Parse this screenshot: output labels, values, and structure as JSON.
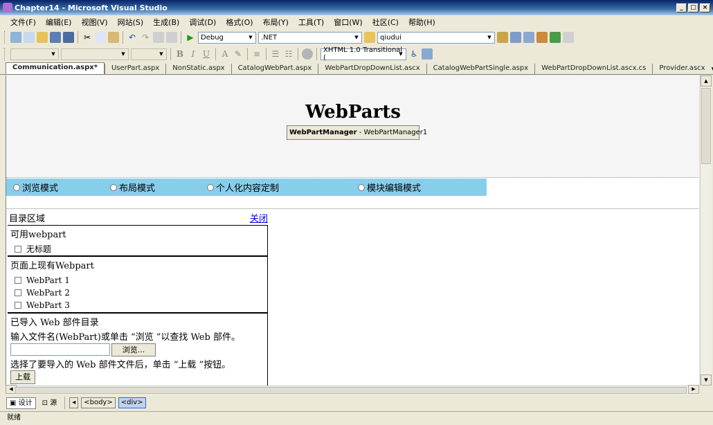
{
  "window": {
    "title": "Chapter14 - Microsoft Visual Studio"
  },
  "menu": [
    "文件(F)",
    "编辑(E)",
    "视图(V)",
    "网站(S)",
    "生成(B)",
    "调试(D)",
    "格式(O)",
    "布局(Y)",
    "工具(T)",
    "窗口(W)",
    "社区(C)",
    "帮助(H)"
  ],
  "toolbar": {
    "config": "Debug",
    "platform": ".NET",
    "search": "qiudui",
    "doctype": "XHTML 1.0 Transitional ("
  },
  "tabs": [
    "Communication.aspx*",
    "UserPart.aspx",
    "NonStatic.aspx",
    "CatalogWebPart.aspx",
    "WebPartDropDownList.ascx",
    "CatalogWebPartSingle.aspx",
    "WebPartDropDownList.ascx.cs",
    "Provider.ascx"
  ],
  "design": {
    "heading": "WebParts",
    "manager_type": "WebPartManager",
    "manager_id": " - WebPartManager1",
    "modes": [
      "浏览模式",
      "布局模式",
      "个人化内容定制",
      "模块编辑模式"
    ],
    "catalog": {
      "title": "目录区域",
      "close": "关闭",
      "available_title": "可用webpart",
      "available_items": [
        "无标题"
      ],
      "page_title": "页面上现有Webpart",
      "page_items": [
        "WebPart 1",
        "WebPart 2",
        "WebPart 3"
      ],
      "import_title": "已导入 Web 部件目录",
      "import_hint": "输入文件名(WebPart)或单击 “浏览 ”以查找 Web 部件。",
      "browse": "浏览...",
      "upload_hint": "选择了要导入的 Web 部件文件后，单击 “上载 ”按钮。",
      "upload": "上载"
    }
  },
  "bottom": {
    "design_view": "设计",
    "source_view": "源",
    "crumbs": [
      "<body>",
      "<div>"
    ]
  },
  "status": "就绪",
  "colors": {
    "mode_bar": "#87ceeb",
    "titlebar": "#0a246a"
  }
}
